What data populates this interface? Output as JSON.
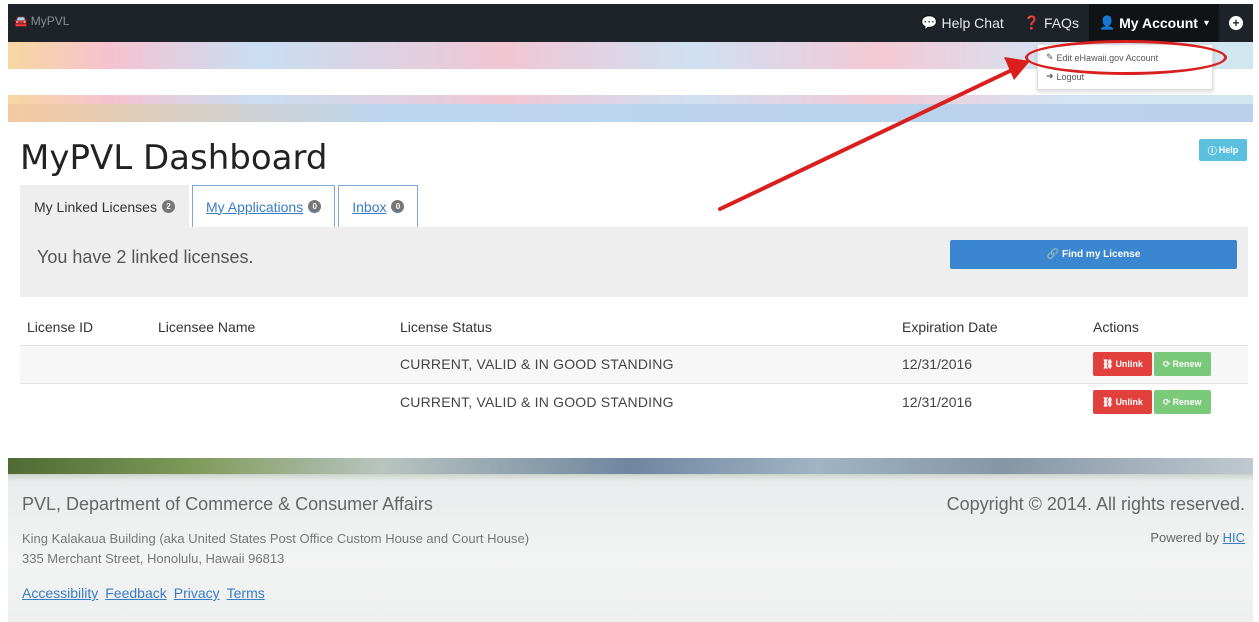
{
  "navbar": {
    "brand": "MyPVL",
    "help_chat": "Help Chat",
    "faqs": "FAQs",
    "my_account": "My Account"
  },
  "dropdown": {
    "edit_account": "Edit eHawaii.gov Account",
    "logout": "Logout"
  },
  "page": {
    "title": "MyPVL Dashboard",
    "help_label": "Help"
  },
  "tabs": [
    {
      "label": "My Linked Licenses",
      "count": "2"
    },
    {
      "label": "My Applications",
      "count": "0"
    },
    {
      "label": "Inbox",
      "count": "0"
    }
  ],
  "linked": {
    "message": "You have 2 linked licenses.",
    "find_label": "Find my License"
  },
  "table": {
    "headers": [
      "License ID",
      "Licensee Name",
      "License Status",
      "Expiration Date",
      "Actions"
    ],
    "rows": [
      {
        "license_id": "",
        "licensee_name": "",
        "status": "CURRENT, VALID & IN GOOD STANDING",
        "expiration": "12/31/2016"
      },
      {
        "license_id": "",
        "licensee_name": "",
        "status": "CURRENT, VALID & IN GOOD STANDING",
        "expiration": "12/31/2016"
      }
    ],
    "unlink_label": "Unlink",
    "renew_label": "Renew"
  },
  "footer": {
    "org": "PVL, Department of Commerce & Consumer Affairs",
    "address_line1": "King Kalakaua Building (aka United States Post Office Custom House and Court House)",
    "address_line2": "335 Merchant Street, Honolulu, Hawaii 96813",
    "links": [
      "Accessibility",
      "Feedback",
      "Privacy",
      "Terms"
    ],
    "copyright": "Copyright © 2014. All rights reserved.",
    "powered_prefix": "Powered by",
    "powered_link": "HIC"
  },
  "colors": {
    "navbar": "#1d2328",
    "primary": "#3a86d0",
    "danger": "#e2403d",
    "success": "#6cc56b",
    "info": "#5bc0de",
    "annotation": "#d9201e"
  }
}
